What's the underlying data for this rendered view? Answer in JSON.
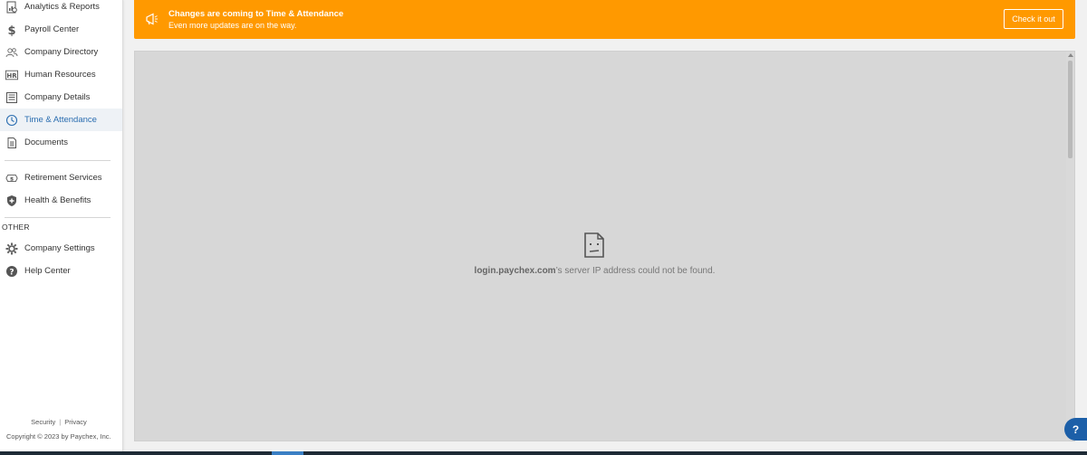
{
  "sidebar": {
    "items": [
      {
        "label": "Analytics & Reports",
        "icon": "analytics-icon"
      },
      {
        "label": "Payroll Center",
        "icon": "dollar-icon"
      },
      {
        "label": "Company Directory",
        "icon": "people-icon"
      },
      {
        "label": "Human Resources",
        "icon": "hr-icon"
      },
      {
        "label": "Company Details",
        "icon": "building-icon"
      },
      {
        "label": "Time & Attendance",
        "icon": "clock-icon",
        "active": true
      },
      {
        "label": "Documents",
        "icon": "document-icon"
      },
      {
        "label": "Retirement Services",
        "icon": "retirement-icon"
      },
      {
        "label": "Health & Benefits",
        "icon": "shield-icon"
      },
      {
        "label": "Company Settings",
        "icon": "gear-icon"
      },
      {
        "label": "Help Center",
        "icon": "help-icon"
      }
    ],
    "other_label": "OTHER",
    "footer": {
      "security": "Security",
      "separator": "|",
      "privacy": "Privacy",
      "copyright": "Copyright © 2023 by Paychex, Inc."
    }
  },
  "banner": {
    "title": "Changes are coming to Time & Attendance",
    "subtitle": "Even more updates are on the way.",
    "cta": "Check it out",
    "color": "#ff9900"
  },
  "error": {
    "host": "login.paychex.com",
    "message": "’s server IP address could not be found."
  },
  "help_button": "?",
  "colors": {
    "active_text": "#2a6db0",
    "help_button": "#1c5fa8"
  }
}
